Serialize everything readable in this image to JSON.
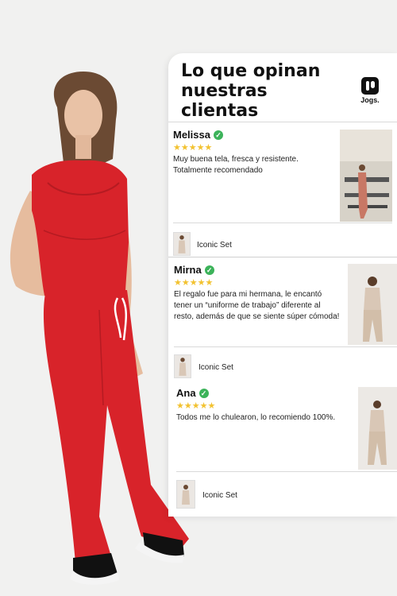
{
  "panel": {
    "title": "Lo que opinan nuestras clientas",
    "brand": {
      "icon": "jogs-logo-icon",
      "name": "Jogs."
    }
  },
  "reviews": [
    {
      "name": "Melissa",
      "verified_icon": "check-circle-icon",
      "rating": 5,
      "stars": "★★★★★",
      "text": "Muy buena tela, fresca y resistente. Totalmente recomendado",
      "product": "Iconic Set"
    },
    {
      "name": "Mirna",
      "verified_icon": "check-circle-icon",
      "rating": 5,
      "stars": "★★★★★",
      "text": "El regalo fue para mi hermana, le encantó tener un “uniforme de trabajo” diferente al resto, además de que se siente súper cómoda!",
      "product": "Iconic Set"
    },
    {
      "name": "Ana",
      "verified_icon": "check-circle-icon",
      "rating": 5,
      "stars": "★★★★★",
      "text": "Todos me lo chulearon, lo recomiendo 100%.",
      "product": "Iconic Set"
    }
  ],
  "colors": {
    "outfit_red": "#d8232a",
    "star": "#f2c230",
    "verified": "#3cb35a",
    "beige_set": "#d9c7b6"
  }
}
